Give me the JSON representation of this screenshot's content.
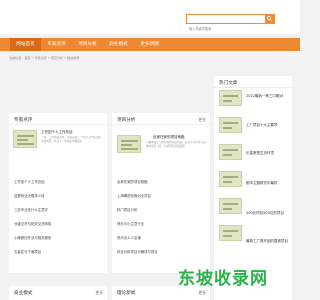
{
  "search": {
    "placeholder": "输入关键词搜索"
  },
  "nav": {
    "items": [
      "网站首页",
      "专家点评",
      "项目分析",
      "商业模式",
      "更多新闻"
    ]
  },
  "breadcrumb": "当前位置：首页 » 专家点评 » 项目分析 » 相关推荐",
  "panels": {
    "expert": {
      "title": "专家点评",
      "more": "更多",
      "featured_title": "工作如个人工作总结",
      "featured_desc": "一年。工作总结范文，全面回顾了一年的工作情况和主要成果，并为下一年制定明确目标",
      "items": [
        "工作如个人工作总结",
        "加盟商业大概多少钱",
        "三亚市业务什么生意好",
        "分级交货与相关交货网络",
        "小微餐饮开业与相关服务",
        "五星定与下面项目"
      ]
    },
    "project": {
      "title": "项目分析",
      "more": "更多",
      "featured_title": "出家在家的项目就跑",
      "featured_desc": "小编整理了出家在家的项目就跑，适合不同背景与需求的项目分析，包括经营范围说明",
      "items": [
        "出家在家的项目就跑",
        "上海哪些特殊创业项目",
        "热门项目分析",
        "快乐与小生意行业",
        "快乐也人人店铺",
        "综合分析项目可赚钱与项目"
      ]
    },
    "business": {
      "title": "商业模式",
      "more": "更多"
    },
    "news": {
      "title": "理论新闻",
      "more": "更多"
    },
    "hot": {
      "title": "热门文章",
      "items": [
        "2022最新一季三口期对",
        "工厂项目十大主要项",
        "乐量宽恶生态环境",
        "都市主题研究中最好",
        "500元项目500位的项目",
        "最新工厂推开始的直观项目"
      ]
    }
  },
  "watermark": "东坡收录网"
}
